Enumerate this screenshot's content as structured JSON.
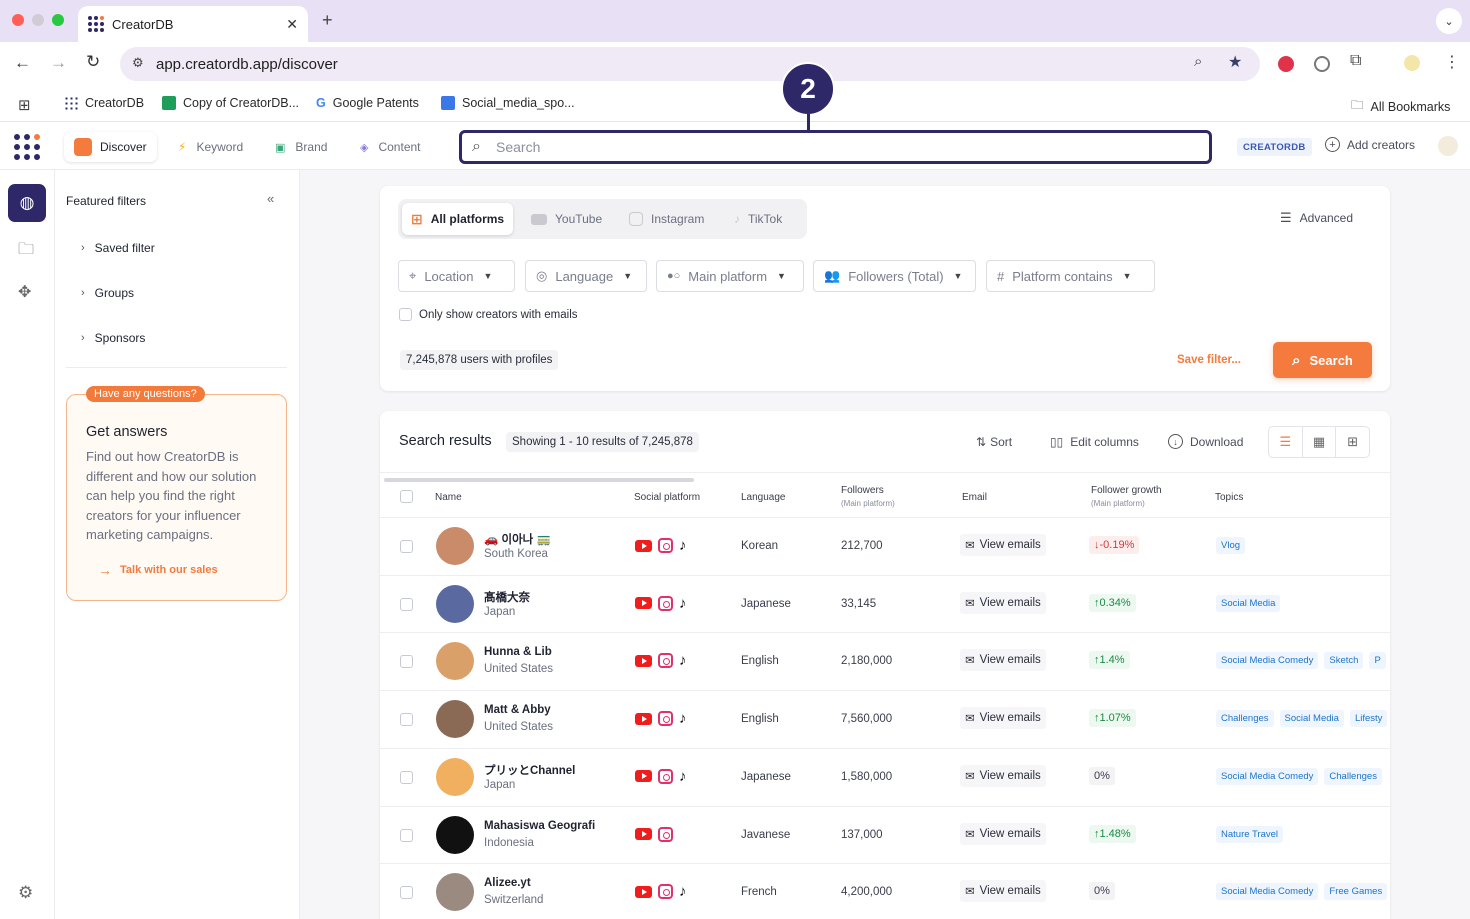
{
  "browser": {
    "tab_title": "CreatorDB",
    "url": "app.creatordb.app/discover",
    "bookmarks": [
      "CreatorDB",
      "Copy of CreatorDB...",
      "Google Patents",
      "Social_media_spo...",
      "All Bookmarks"
    ]
  },
  "app": {
    "nav": [
      "Discover",
      "Keyword",
      "Brand",
      "Content"
    ],
    "search_placeholder": "Search",
    "brand_badge": "CREATORDB",
    "add_creators": "Add creators"
  },
  "sidebar": {
    "title": "Featured filters",
    "items": [
      "Saved filter",
      "Groups",
      "Sponsors"
    ],
    "help": {
      "badge": "Have any questions?",
      "title": "Get answers",
      "body": "Find out how CreatorDB is different and how our solution can help you find the right creators for your influencer marketing campaigns.",
      "cta": "Talk with our sales"
    }
  },
  "filters": {
    "platforms": [
      "All platforms",
      "YouTube",
      "Instagram",
      "TikTok"
    ],
    "advanced": "Advanced",
    "dropdowns": [
      "Location",
      "Language",
      "Main platform",
      "Followers (Total)",
      "Platform contains"
    ],
    "email_only": "Only show creators with emails",
    "count": "7,245,878 users with profiles",
    "save_filter": "Save filter...",
    "search_button": "Search"
  },
  "results": {
    "title": "Search results",
    "showing": "Showing 1 - 10 results of 7,245,878",
    "sort": "Sort",
    "edit_columns": "Edit columns",
    "download": "Download",
    "columns": {
      "name": "Name",
      "platform": "Social platform",
      "language": "Language",
      "followers": "Followers",
      "followers_sub": "(Main platform)",
      "email": "Email",
      "growth": "Follower growth",
      "growth_sub": "(Main platform)",
      "topics": "Topics"
    },
    "rows": [
      {
        "name": "🚗 이아나 🚃",
        "country": "South Korea",
        "platforms": [
          "yt",
          "ig",
          "tt"
        ],
        "language": "Korean",
        "followers": "212,700",
        "email": "View emails",
        "growth": "-0.19%",
        "growth_dir": "down",
        "topics": [
          "Vlog"
        ],
        "avatar": "#c98b6a"
      },
      {
        "name": "髙橋大奈",
        "country": "Japan",
        "platforms": [
          "yt",
          "ig",
          "tt"
        ],
        "language": "Japanese",
        "followers": "33,145",
        "email": "View emails",
        "growth": "0.34%",
        "growth_dir": "up",
        "topics": [
          "Social Media"
        ],
        "avatar": "#5a6aa0"
      },
      {
        "name": "Hunna & Lib",
        "country": "United States",
        "platforms": [
          "yt",
          "ig",
          "tt"
        ],
        "language": "English",
        "followers": "2,180,000",
        "email": "View emails",
        "growth": "1.4%",
        "growth_dir": "up",
        "topics": [
          "Social Media Comedy",
          "Sketch",
          "P"
        ],
        "avatar": "#d9a06a"
      },
      {
        "name": "Matt & Abby",
        "country": "United States",
        "platforms": [
          "yt",
          "ig",
          "tt"
        ],
        "language": "English",
        "followers": "7,560,000",
        "email": "View emails",
        "growth": "1.07%",
        "growth_dir": "up",
        "topics": [
          "Challenges",
          "Social Media",
          "Lifesty"
        ],
        "avatar": "#8a6a55"
      },
      {
        "name": "プリッとChannel",
        "country": "Japan",
        "platforms": [
          "yt",
          "ig",
          "tt"
        ],
        "language": "Japanese",
        "followers": "1,580,000",
        "email": "View emails",
        "growth": "0%",
        "growth_dir": "none",
        "topics": [
          "Social Media Comedy",
          "Challenges"
        ],
        "avatar": "#f0b060"
      },
      {
        "name": "Mahasiswa Geografi",
        "country": "Indonesia",
        "platforms": [
          "yt",
          "ig"
        ],
        "language": "Javanese",
        "followers": "137,000",
        "email": "View emails",
        "growth": "1.48%",
        "growth_dir": "up",
        "topics": [
          "Nature Travel"
        ],
        "avatar": "#111111"
      },
      {
        "name": "Alizee.yt",
        "country": "Switzerland",
        "platforms": [
          "yt",
          "ig",
          "tt"
        ],
        "language": "French",
        "followers": "4,200,000",
        "email": "View emails",
        "growth": "0%",
        "growth_dir": "none",
        "topics": [
          "Social Media Comedy",
          "Free Games"
        ],
        "avatar": "#9a8a80"
      }
    ]
  },
  "annotation": "2"
}
